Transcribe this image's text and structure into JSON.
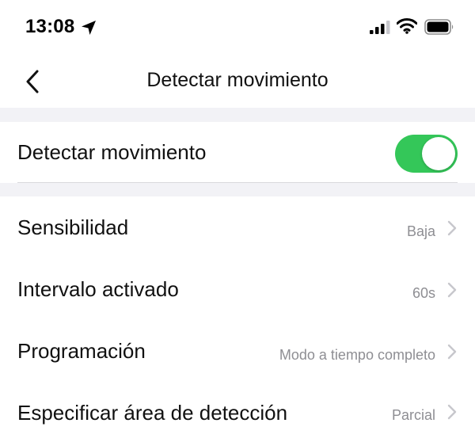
{
  "status_bar": {
    "time": "13:08",
    "icons": [
      "location-arrow-icon",
      "cellular-signal-icon",
      "wifi-icon",
      "battery-icon"
    ]
  },
  "nav": {
    "title": "Detectar movimiento",
    "back_icon": "chevron-left-icon"
  },
  "motion_detection": {
    "label": "Detectar movimiento",
    "enabled": true,
    "toggle_color": "#34c759"
  },
  "settings": [
    {
      "label": "Sensibilidad",
      "value": "Baja"
    },
    {
      "label": "Intervalo activado",
      "value": "60s"
    },
    {
      "label": "Programación",
      "value": "Modo a tiempo completo"
    },
    {
      "label": "Especificar área de detección",
      "value": "Parcial"
    }
  ],
  "colors": {
    "accent": "#34c759",
    "secondary_text": "#8e8e93",
    "section_background": "#f2f2f6"
  }
}
